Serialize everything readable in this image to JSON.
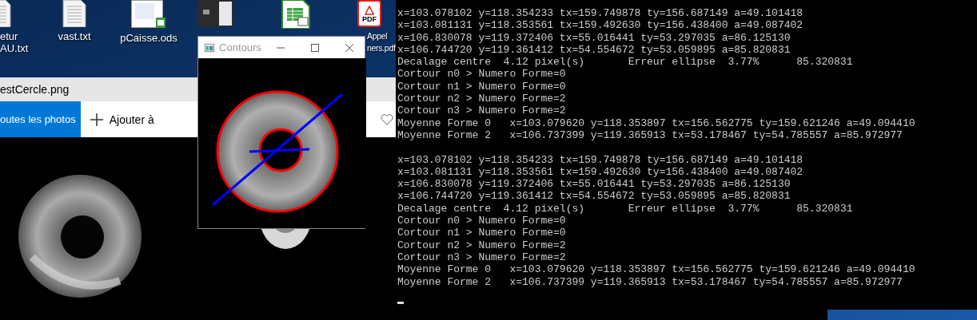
{
  "desktop": {
    "icons": [
      {
        "kind": "text-file",
        "label_lines": [
          "etur",
          "AU.txt"
        ]
      },
      {
        "kind": "text-file",
        "label_lines": [
          "vast.txt"
        ]
      },
      {
        "kind": "spreadsheet-doc",
        "label_lines": [
          "pCaisse.ods"
        ]
      },
      {
        "kind": "screenshot"
      },
      {
        "kind": "spreadsheet"
      },
      {
        "kind": "pdf",
        "badge": "PDF",
        "label_lines": [
          "Appel",
          "ners.pdf"
        ]
      }
    ]
  },
  "photos_window": {
    "title": "estCercle.png",
    "all_photos_button": "outes les photos",
    "add_button": "Ajouter à"
  },
  "contours_window": {
    "title": "Contours"
  },
  "console": {
    "blocks": [
      {
        "lines": [
          "x=103.078102 y=118.354233 tx=159.749878 ty=156.687149 a=49.101418",
          "x=103.081131 y=118.353561 tx=159.492630 ty=156.438400 a=49.087402",
          "x=106.830078 y=119.372406 tx=55.016441 ty=53.297035 a=86.125130",
          "x=106.744720 y=119.361412 tx=54.554672 ty=53.059895 a=85.820831",
          "Decalage centre  4.12 pixel(s)       Erreur ellipse  3.77%      85.320831",
          "Cortour n0 > Numero Forme=0",
          "Cortour n1 > Numero Forme=0",
          "Cortour n2 > Numero Forme=2",
          "Cortour n3 > Numero Forme=2",
          "Moyenne Forme 0   x=103.079620 y=118.353897 tx=156.562775 ty=159.621246 a=49.094410",
          "Moyenne Forme 2   x=106.737399 y=119.365913 tx=53.178467 ty=54.785557 a=85.972977"
        ]
      },
      {
        "lines": [
          "x=103.078102 y=118.354233 tx=159.749878 ty=156.687149 a=49.101418",
          "x=103.081131 y=118.353561 tx=159.492630 ty=156.438400 a=49.087402",
          "x=106.830078 y=119.372406 tx=55.016441 ty=53.297035 a=86.125130",
          "x=106.744720 y=119.361412 tx=54.554672 ty=53.059895 a=85.820831",
          "Decalage centre  4.12 pixel(s)       Erreur ellipse  3.77%      85.320831",
          "Cortour n0 > Numero Forme=0",
          "Cortour n1 > Numero Forme=0",
          "Cortour n2 > Numero Forme=2",
          "Cortour n3 > Numero Forme=2",
          "Moyenne Forme 0   x=103.079620 y=118.353897 tx=156.562775 ty=159.621246 a=49.094410",
          "Moyenne Forme 2   x=106.737399 y=119.365913 tx=53.178467 ty=54.785557 a=85.972977"
        ]
      }
    ]
  }
}
